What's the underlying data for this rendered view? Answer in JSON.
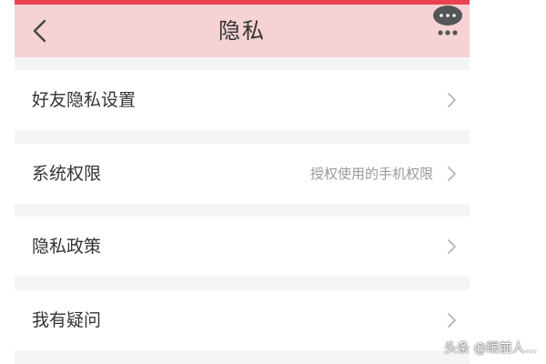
{
  "header": {
    "title": "隐私",
    "back_icon": "chevron-left-icon",
    "more_icon": "more-dots-icon"
  },
  "settings": {
    "items": [
      {
        "label": "好友隐私设置",
        "value": ""
      },
      {
        "label": "系统权限",
        "value": "授权使用的手机权限"
      },
      {
        "label": "隐私政策",
        "value": ""
      },
      {
        "label": "我有疑问",
        "value": ""
      }
    ]
  },
  "watermark": {
    "text": "头条 @眼前人..."
  },
  "colors": {
    "top_strip": "#e8434f",
    "header_bg": "#f5d2d4",
    "page_bg": "#f5f5f7"
  }
}
